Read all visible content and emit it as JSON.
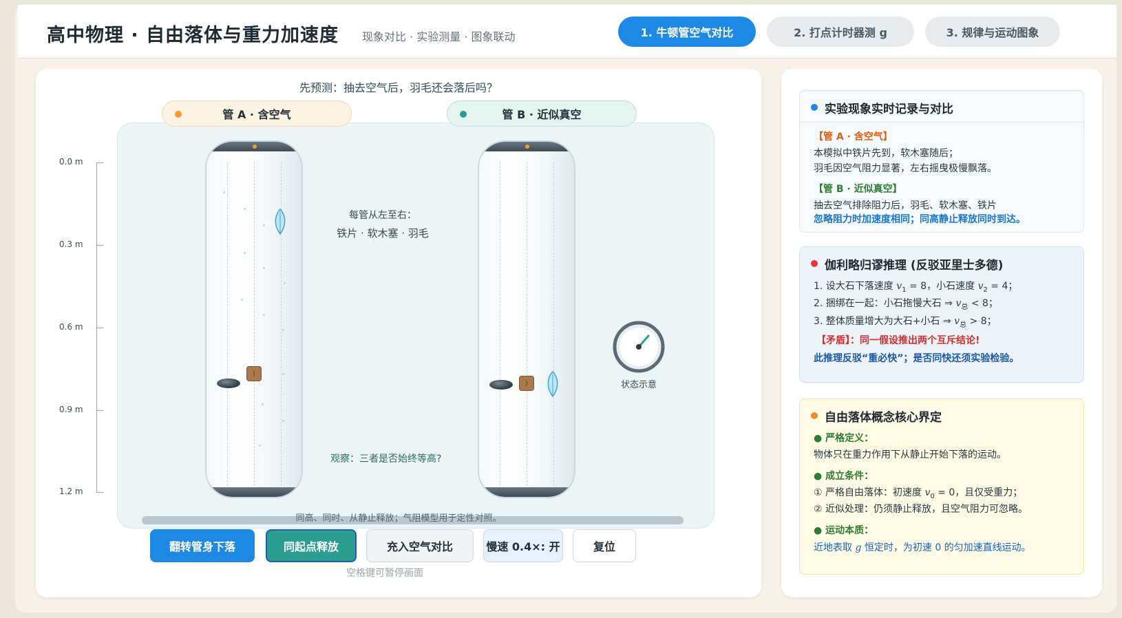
{
  "header": {
    "title": "高中物理 · 自由落体与重力加速度",
    "subtitle": "现象对比 · 实验测量 · 图象联动",
    "tabs": [
      {
        "label": "1. 牛顿管空气对比",
        "active": true
      },
      {
        "label": "2. 打点计时器测 g",
        "active": false
      },
      {
        "label": "3. 规律与运动图象",
        "active": false
      }
    ]
  },
  "stage": {
    "prompt": "先预测：抽去空气后，羽毛还会落后吗？",
    "tube_a_label": "管 A · 含空气",
    "tube_b_label": "管 B · 近似真空",
    "scale_ticks": [
      "0.0 m",
      "0.3 m",
      "0.6 m",
      "0.9 m",
      "1.2 m"
    ],
    "order_note_title": "每管从左至右：",
    "order_note_items": "铁片 · 软木塞 · 羽毛",
    "observe_note": "观察：三者是否始终等高?",
    "gauge_label": "状态示意",
    "footnote": "同高、同时、从静止释放；气阻模型用于定性对照。",
    "buttons": {
      "flip": "翻转管身下落",
      "release": "同起点释放",
      "air": "充入空气对比",
      "slow": "慢速 0.4×: 开",
      "reset": "复位"
    },
    "hint": "空格键可暂停画面",
    "colors": {
      "tube_a_dot": "#f59e2f",
      "tube_b_dot": "#2a9d8f",
      "accent": "#1e88e5"
    }
  },
  "cards": {
    "record": {
      "title": "实验现象实时记录与对比",
      "a_head": "【管 A · 含空气】",
      "a_line1": "本模拟中铁片先到，软木塞随后；",
      "a_line2": "羽毛因空气阻力显著，左右摇曳极慢飘落。",
      "b_head": "【管 B · 近似真空】",
      "b_line1": "抽去空气排除阻力后，羽毛、软木塞、铁片",
      "b_line2": "忽略阻力时加速度相同；同高静止释放同时到达。"
    },
    "galileo": {
      "title": "伽利略归谬推理 (反驳亚里士多德)",
      "l1_pre": "1. 设大石下落速度 ",
      "l1_mid": " = 8，小石速度 ",
      "l1_post": " = 4；",
      "l2_pre": "2. 捆绑在一起：小石拖慢大石 ⇒ ",
      "l2_post": " < 8；",
      "l3_pre": "3. 整体质量增大为大石+小石 ⇒ ",
      "l3_post": " > 8；",
      "sub_total": "总",
      "contradiction": "【矛盾】：同一假设推出两个互斥结论!",
      "conclusion": "此推理反驳“重必快”；是否同快还须实验检验。"
    },
    "concept": {
      "title": "自由落体概念核心界定",
      "def_head": "● 严格定义：",
      "def_text": "物体只在重力作用下从静止开始下落的运动。",
      "cond_head": "● 成立条件：",
      "cond1_pre": "① 严格自由落体：初速度 ",
      "cond1_post": " = 0，且仅受重力；",
      "cond2": "② 近似处理：仍须静止释放，且空气阻力可忽略。",
      "nature_head": "● 运动本质：",
      "nature_pre": "近地表取 ",
      "nature_post": " 恒定时，为初速 0 的匀加速直线运动。"
    }
  }
}
